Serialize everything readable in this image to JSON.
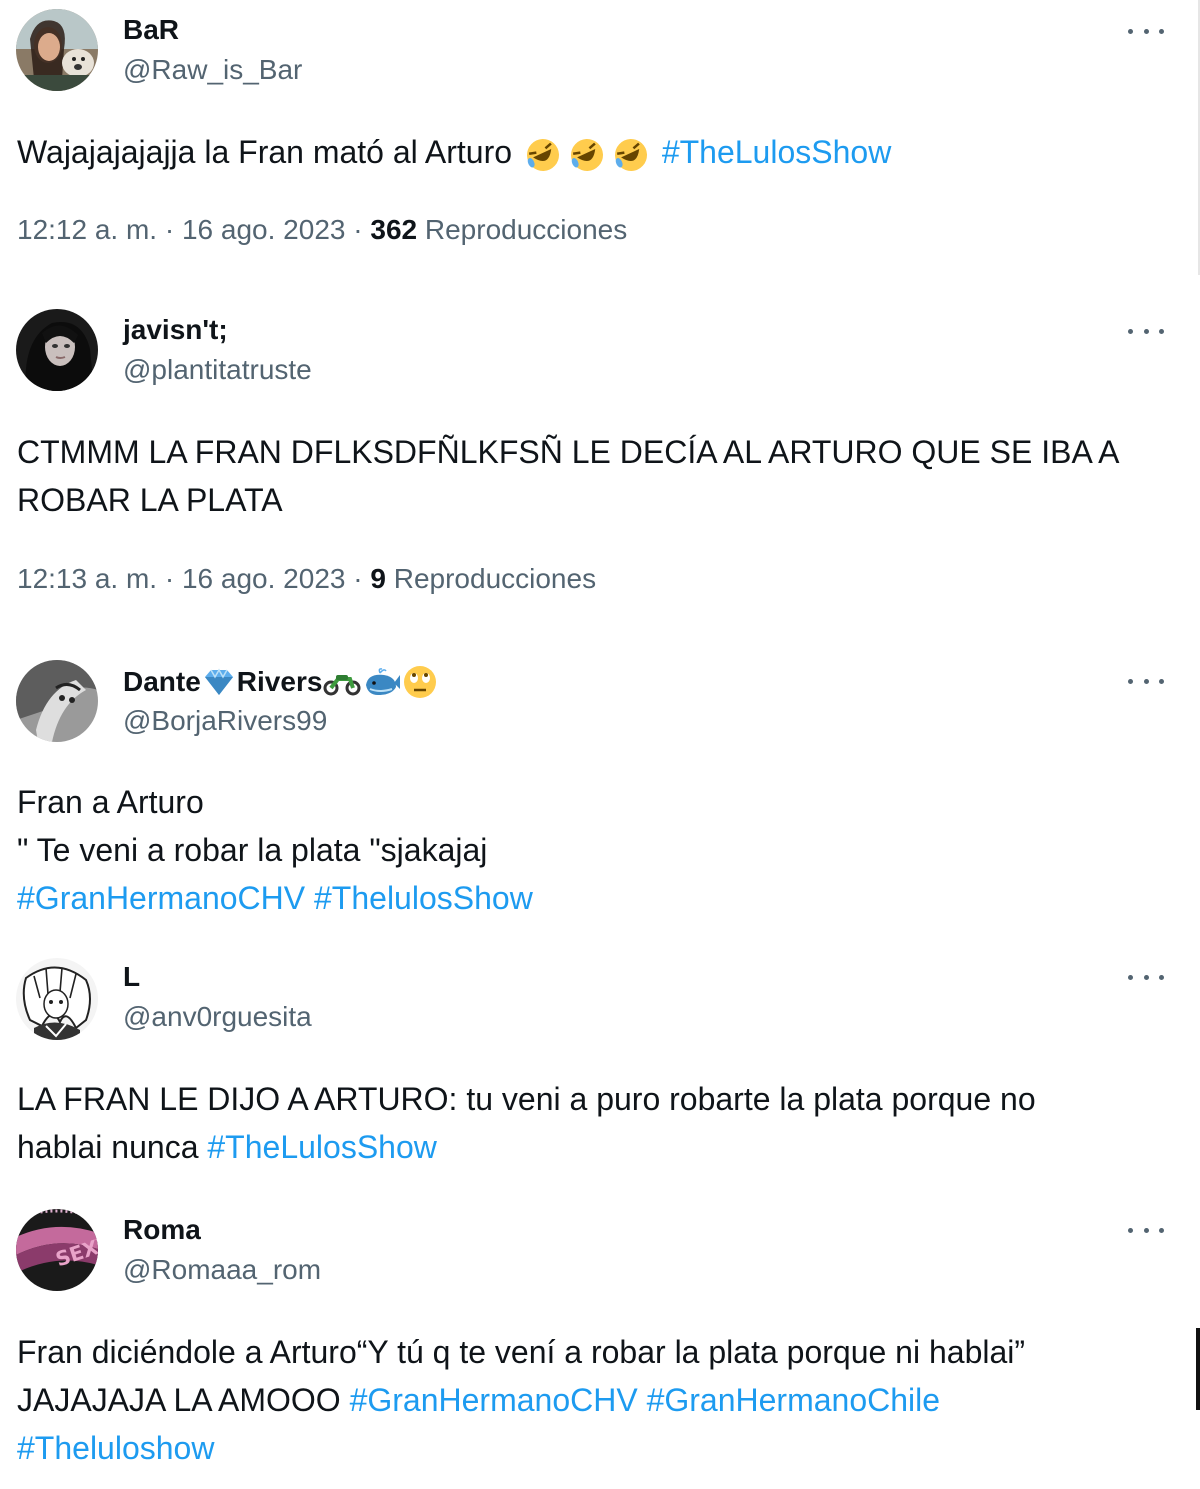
{
  "tweets": [
    {
      "name": "BaR",
      "handle": "@Raw_is_Bar",
      "text_before": "Wajajajajajja la Fran mató al Arturo ",
      "hashtag": "#TheLulosShow",
      "time": "12:12 a. m.",
      "date": "16 ago. 2023",
      "views": "362",
      "views_label": "Reproducciones",
      "emoji": [
        "rolling-on-floor-laughing",
        "rolling-on-floor-laughing",
        "rolling-on-floor-laughing"
      ]
    },
    {
      "name": "javisn't;",
      "handle": "@plantitatruste",
      "line1": "CTMMM LA FRAN DFLKSDFÑLKFSÑ LE DECÍA AL ARTURO QUE SE IBA A",
      "line2": "ROBAR LA PLATA",
      "time": "12:13 a. m.",
      "date": "16 ago. 2023",
      "views": "9",
      "views_label": "Reproducciones"
    },
    {
      "name_part1": "Dante",
      "name_part2": "Rivers",
      "name_emoji": [
        "gem-icon",
        "motorcycle-icon",
        "whale-icon",
        "eye-roll-face-icon"
      ],
      "handle": "@BorjaRivers99",
      "line1": "Fran a Arturo",
      "line2": "\" Te veni a robar la plata \"sjakajaj",
      "hashtag1": "#GranHermanoCHV",
      "hashtag2": "#ThelulosShow"
    },
    {
      "name": "L",
      "handle": "@anv0rguesita",
      "line1": "LA FRAN LE DIJO A ARTURO: tu veni a puro robarte la plata porque no",
      "line2_text": "hablai nunca ",
      "hashtag": "#TheLulosShow"
    },
    {
      "name": "Roma",
      "handle": "@Romaaa_rom",
      "line1": "Fran diciéndole a Arturo“Y tú q te vení a robar la plata porque ni hablai”",
      "line2_text": "JAJAJAJA LA AMOOO ",
      "hashtag1": "#GranHermanoCHV",
      "hashtag2": "#GranHermanoChile",
      "hashtag3": "#Theluloshow"
    }
  ],
  "colors": {
    "accent": "#1d9bf0",
    "secondary_text": "#536471",
    "primary_text": "#0f1419"
  }
}
